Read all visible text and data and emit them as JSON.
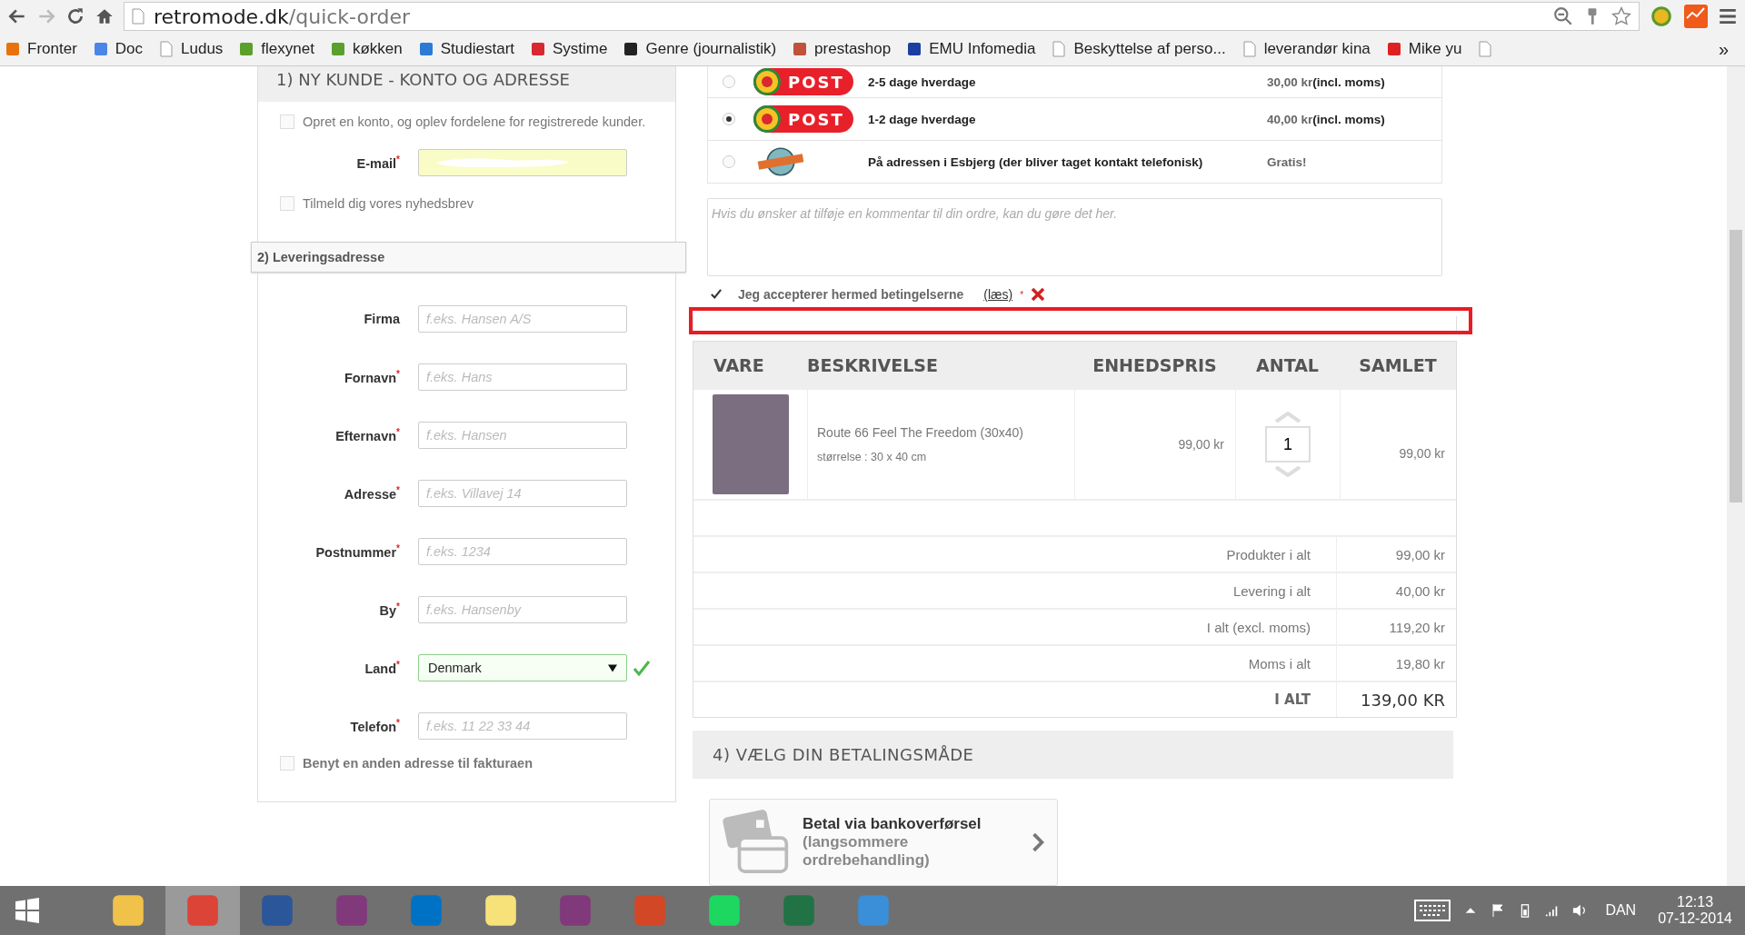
{
  "browser": {
    "url_host": "retromode.dk",
    "url_path": "/quick-order",
    "bookmarks": [
      {
        "label": "Fronter",
        "kind": "site",
        "color": "#e8730c"
      },
      {
        "label": "Doc",
        "kind": "site",
        "color": "#4a86e8"
      },
      {
        "label": "Ludus",
        "kind": "page"
      },
      {
        "label": "flexynet",
        "kind": "site",
        "color": "#5aa02c"
      },
      {
        "label": "køkken",
        "kind": "site",
        "color": "#5aa02c"
      },
      {
        "label": "Studiestart",
        "kind": "site",
        "color": "#2b7bd6"
      },
      {
        "label": "Systime",
        "kind": "site",
        "color": "#d9282f"
      },
      {
        "label": "Genre (journalistik)",
        "kind": "site",
        "color": "#222222"
      },
      {
        "label": "prestashop",
        "kind": "site",
        "color": "#c0513a"
      },
      {
        "label": "EMU Infomedia",
        "kind": "site",
        "color": "#1b3fa0"
      },
      {
        "label": "Beskyttelse af perso...",
        "kind": "page"
      },
      {
        "label": "leverandør kina",
        "kind": "page"
      },
      {
        "label": "Mike yu",
        "kind": "site",
        "color": "#e02020"
      },
      {
        "kind": "page"
      }
    ],
    "more": "»"
  },
  "customer": {
    "title": "1) NY KUNDE - KONTO OG ADRESSE",
    "create_account": {
      "label": "Opret en konto, og oplev fordelene for registrerede kunder.",
      "checked": false
    },
    "email": {
      "label": "E-mail",
      "required_mark": "*"
    },
    "newsletter": {
      "label": "Tilmeld dig vores nyhedsbrev",
      "checked": false
    },
    "delivery_title": "2) Leveringsadresse",
    "fields": [
      {
        "kind": "text",
        "label": "Firma",
        "placeholder": "f.eks. Hansen A/S"
      },
      {
        "kind": "text",
        "label": "Fornavn",
        "required_mark": "*",
        "placeholder": "f.eks. Hans"
      },
      {
        "kind": "text",
        "label": "Efternavn",
        "required_mark": "*",
        "placeholder": "f.eks. Hansen"
      },
      {
        "kind": "text",
        "label": "Adresse",
        "required_mark": "*",
        "placeholder": "f.eks. Villavej 14"
      },
      {
        "kind": "text",
        "label": "Postnummer",
        "required_mark": "*",
        "placeholder": "f.eks. 1234"
      },
      {
        "kind": "text",
        "label": "By",
        "required_mark": "*",
        "placeholder": "f.eks. Hansenby"
      },
      {
        "kind": "select",
        "label": "Land",
        "required_mark": "*",
        "value": "Denmark",
        "valid": true
      },
      {
        "kind": "text",
        "label": "Telefon",
        "required_mark": "*",
        "placeholder": "f.eks. 11 22 33 44"
      }
    ],
    "invoice_address": {
      "label": "Benyt en anden adresse til fakturaen",
      "checked": false
    }
  },
  "shipping": {
    "options": [
      {
        "kind": "post",
        "logo_text": "POST",
        "description": "2-5 dage hverdage",
        "price": "30,00 kr",
        "price_note": "(incl. moms)",
        "selected": false
      },
      {
        "kind": "post",
        "logo_text": "POST",
        "description": "1-2 dage hverdage",
        "price": "40,00 kr",
        "price_note": "(incl. moms)",
        "selected": true
      },
      {
        "kind": "pickup",
        "description": "På adressen i Esbjerg (der bliver taget kontakt telefonisk)",
        "price": "Gratis!",
        "selected": false
      }
    ],
    "comment_placeholder": "Hvis du ønsker at tilføje en kommentar til din ordre, kan du gøre det her.",
    "terms": {
      "label": "Jeg accepterer hermed betingelserne",
      "link": "(læs)",
      "required_mark": "*",
      "checked": true,
      "error": true
    }
  },
  "cart": {
    "columns": [
      "VARE",
      "BESKRIVELSE",
      "ENHEDSPRIS",
      "ANTAL",
      "SAMLET"
    ],
    "items": [
      {
        "name": "Route 66 Feel The Freedom (30x40)",
        "attribute": "størrelse : 30 x 40 cm",
        "unit_price": "99,00 kr",
        "quantity": "1",
        "total": "99,00 kr"
      }
    ],
    "totals": [
      {
        "kind": "line",
        "label": "Produkter i alt",
        "value": "99,00 kr"
      },
      {
        "kind": "line",
        "label": "Levering i alt",
        "value": "40,00 kr"
      },
      {
        "kind": "line",
        "label": "I alt (excl. moms)",
        "value": "119,20 kr"
      },
      {
        "kind": "line",
        "label": "Moms i alt",
        "value": "19,80 kr"
      },
      {
        "kind": "grand",
        "label": "I ALT",
        "value": "139,00 KR"
      }
    ]
  },
  "payment": {
    "title": "4) VÆLG DIN BETALINGSMÅDE",
    "options": [
      {
        "title": "Betal via bankoverførsel",
        "subtitle": "(langsommere ordrebehandling)"
      }
    ]
  },
  "taskbar": {
    "apps": [
      {
        "color": "#f0c24a",
        "selected": false
      },
      {
        "color": "#db4437",
        "selected": true
      },
      {
        "color": "#2b579a",
        "selected": false
      },
      {
        "color": "#80397b",
        "selected": false
      },
      {
        "color": "#0072c6",
        "selected": false
      },
      {
        "color": "#f7e27a",
        "selected": false
      },
      {
        "color": "#80397b",
        "selected": false
      },
      {
        "color": "#d24726",
        "selected": false
      },
      {
        "color": "#1ed760",
        "selected": false
      },
      {
        "color": "#217346",
        "selected": false
      },
      {
        "color": "#3a8fd8",
        "selected": false
      }
    ],
    "language": "DAN",
    "time": "12:13",
    "date": "07-12-2014"
  }
}
